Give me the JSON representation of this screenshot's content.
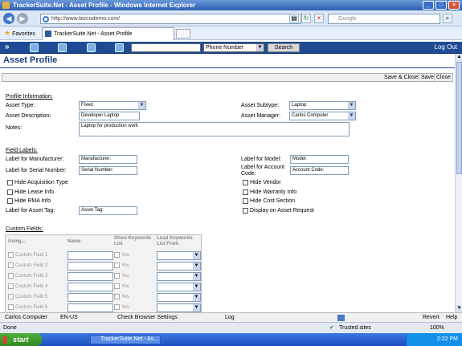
{
  "window": {
    "title": "TrackerSuite.Net - Asset Profile - Windows Internet Explorer"
  },
  "browser": {
    "url": "http://www.bizcodemo.com/",
    "search_placeholder": "Google",
    "favorites_label": "Favorites",
    "tab_title": "TrackerSuite.Net - Asset Profile"
  },
  "appbar": {
    "search_type": "Phone Number",
    "search_button": "Search",
    "logout": "Log Out"
  },
  "page": {
    "title": "Asset Profile"
  },
  "actions": {
    "save_close": "Save & Close",
    "save": "Save",
    "close": "Close"
  },
  "profile": {
    "section": "Profile Information:",
    "asset_type_label": "Asset Type:",
    "asset_type_value": "Fixed",
    "asset_subtype_label": "Asset Subtype:",
    "asset_subtype_value": "Laptop",
    "asset_description_label": "Asset Description:",
    "asset_description_value": "Developer Laptop",
    "asset_manager_label": "Asset Manager:",
    "asset_manager_value": "Carlos Computer",
    "notes_label": "Notes:",
    "notes_value": "Laptop for production work"
  },
  "field_labels": {
    "section": "Field Labels:",
    "manufacturer_label": "Label for Manufacturer:",
    "manufacturer_value": "Manufacturer:",
    "model_label": "Label for Model:",
    "model_value": "Model:",
    "serial_label": "Label for Serial Number:",
    "serial_value": "Serial Number:",
    "account_label_1": "Label for Account",
    "account_label_2": "Code:",
    "account_value": "Account Code:",
    "hide_acq": "Hide Acquisition Type",
    "hide_vendor": "Hide Vendor",
    "hide_lease": "Hide Lease Info",
    "hide_warranty": "Hide Warranty Info",
    "hide_rma": "Hide RMA Info",
    "hide_cost": "Hide Cost Section",
    "asset_tag_label": "Label for Asset Tag:",
    "asset_tag_value": "Asset Tag:",
    "display_request": "Display on Asset Request"
  },
  "custom_fields": {
    "section": "Custom Fields:",
    "col_using": "Using...",
    "col_name": "Name",
    "col_show_1": "Show Keywords",
    "col_show_2": "List",
    "col_load_1": "Load Keywords",
    "col_load_2": "List From",
    "yes": "Yes",
    "rows": [
      "Custom Field 1",
      "Custom Field 2",
      "Custom Field 3",
      "Custom Field 4",
      "Custom Field 5",
      "Custom Field 6"
    ]
  },
  "app_status": {
    "user": "Carlos Computer",
    "locale": "EN-US",
    "check": "Check Browser Settings",
    "log": "Log",
    "revert": "Revert",
    "help": "Help"
  },
  "ie_status": {
    "left": "Done",
    "zone": "Trusted sites",
    "zoom": "100%"
  },
  "taskbar": {
    "start": "start",
    "item": "TrackerSuite.Net - As...",
    "clock": "2:22 PM"
  }
}
